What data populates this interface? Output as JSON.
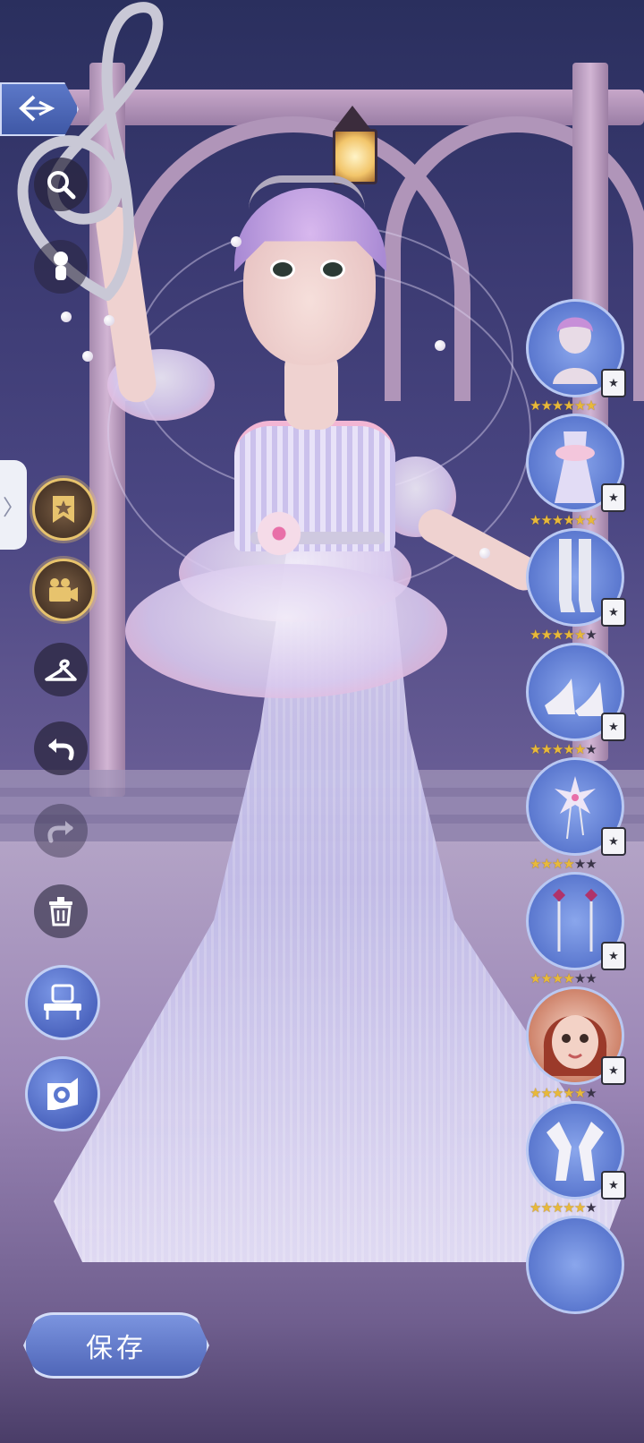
{
  "toolbar": {
    "back_icon": "back-arrow-icon",
    "zoom_icon": "magnify-icon",
    "pose_icon": "flower-pose-icon",
    "side_tab_label": "〉",
    "star_bookmark_icon": "star-bookmark-icon",
    "camera_icon": "video-camera-icon",
    "hanger_icon": "hanger-icon",
    "undo_icon": "undo-icon",
    "redo_icon": "redo-icon",
    "delete_icon": "trash-icon",
    "vanity_icon": "vanity-table-icon",
    "photo_icon": "camera-icon"
  },
  "items": [
    {
      "category": "hair",
      "stars": 6,
      "max": 6,
      "badge": "★"
    },
    {
      "category": "dress",
      "stars": 6,
      "max": 6,
      "badge": "★"
    },
    {
      "category": "socks",
      "stars": 5,
      "max": 6,
      "badge": "★"
    },
    {
      "category": "shoes",
      "stars": 5,
      "max": 6,
      "badge": "★"
    },
    {
      "category": "hair-accessory",
      "stars": 4,
      "max": 6,
      "badge": "★"
    },
    {
      "category": "earrings",
      "stars": 4,
      "max": 6,
      "badge": "★"
    },
    {
      "category": "makeup",
      "stars": 5,
      "max": 6,
      "badge": "★"
    },
    {
      "category": "gloves",
      "stars": 5,
      "max": 6,
      "badge": "★"
    }
  ],
  "save_label": "保存",
  "colors": {
    "accent_blue": "#5b78cf",
    "gold": "#e7c36d",
    "star": "#e8b93a"
  }
}
